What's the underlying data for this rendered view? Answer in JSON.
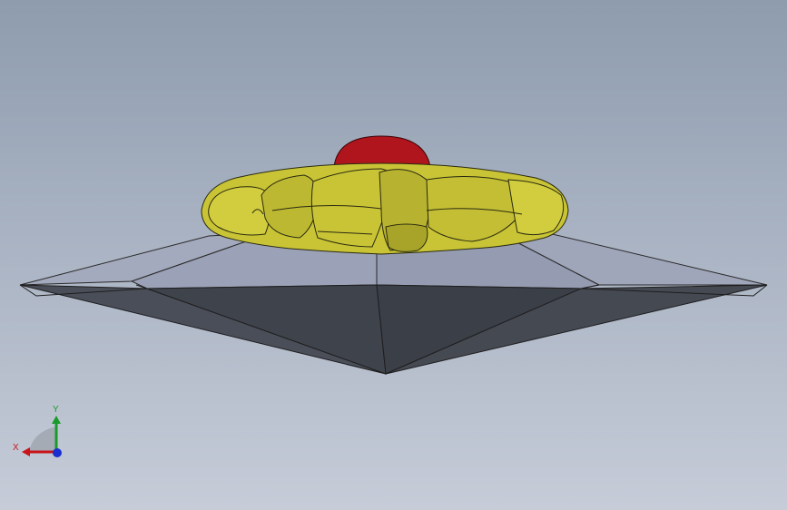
{
  "viewport": {
    "background_top": "#8e9cae",
    "background_bottom": "#c6ccd8"
  },
  "model": {
    "base_color": "#9aa0b4",
    "base_shadow_color": "#3f434c",
    "body_color": "#c9c436",
    "dome_color": "#b0141c"
  },
  "triad": {
    "x_label": "X",
    "y_label": "Y",
    "x_color": "#c8151b",
    "y_color": "#1a9a2a",
    "z_color": "#1a2fd0"
  }
}
